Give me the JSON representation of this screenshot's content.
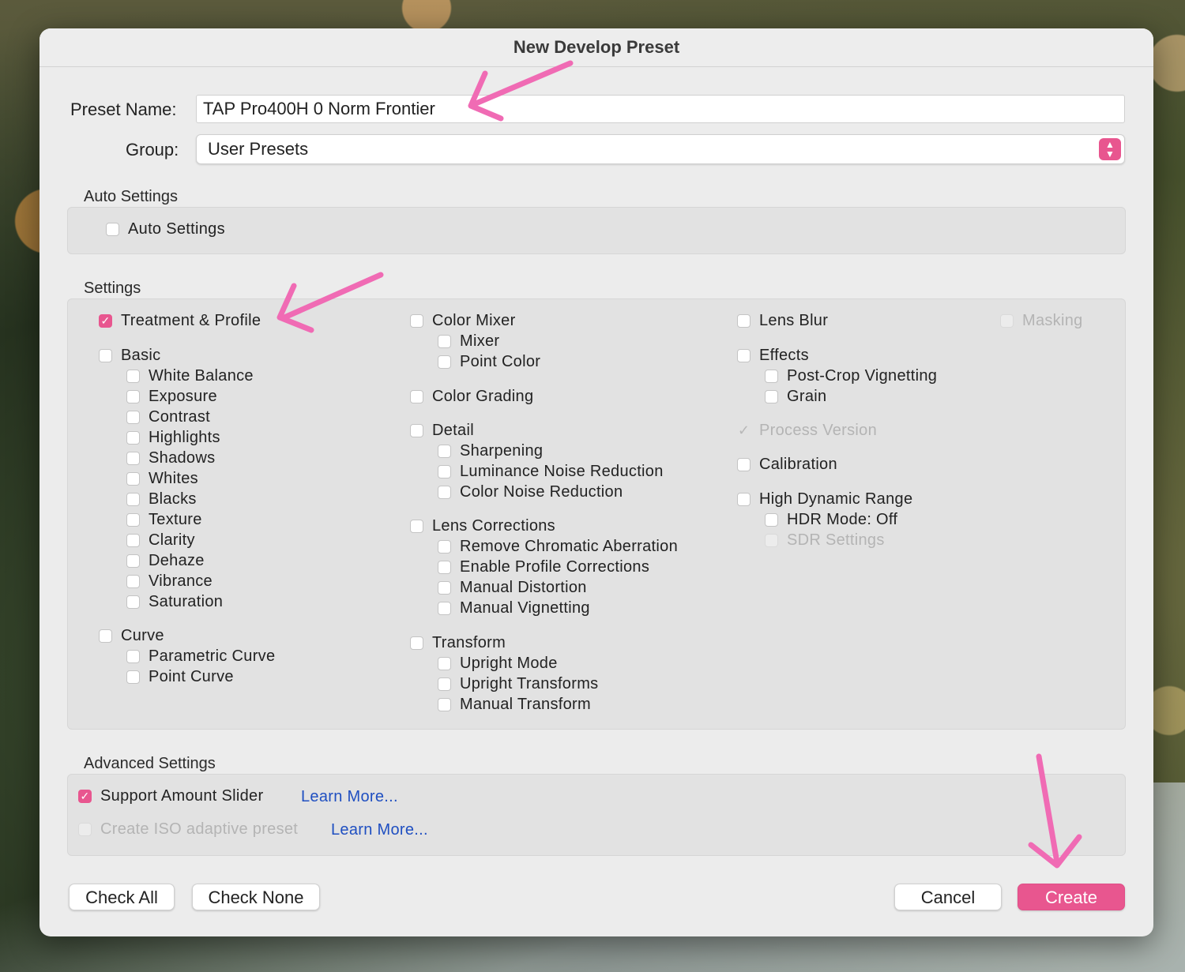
{
  "dialog": {
    "title": "New Develop Preset",
    "preset_name_label": "Preset Name:",
    "preset_name_value": "TAP Pro400H 0 Norm Frontier",
    "group_label": "Group:",
    "group_value": "User Presets"
  },
  "auto_settings": {
    "title": "Auto Settings",
    "checkbox": "Auto Settings"
  },
  "settings": {
    "title": "Settings",
    "col1": {
      "treatment": "Treatment & Profile",
      "basic": "Basic",
      "white_balance": "White Balance",
      "exposure": "Exposure",
      "contrast": "Contrast",
      "highlights": "Highlights",
      "shadows": "Shadows",
      "whites": "Whites",
      "blacks": "Blacks",
      "texture": "Texture",
      "clarity": "Clarity",
      "dehaze": "Dehaze",
      "vibrance": "Vibrance",
      "saturation": "Saturation",
      "curve": "Curve",
      "parametric_curve": "Parametric Curve",
      "point_curve": "Point Curve"
    },
    "col2": {
      "color_mixer": "Color Mixer",
      "mixer": "Mixer",
      "point_color": "Point Color",
      "color_grading": "Color Grading",
      "detail": "Detail",
      "sharpening": "Sharpening",
      "luminance_nr": "Luminance Noise Reduction",
      "color_nr": "Color Noise Reduction",
      "lens_corrections": "Lens Corrections",
      "remove_ca": "Remove Chromatic Aberration",
      "enable_profile": "Enable Profile Corrections",
      "manual_distortion": "Manual Distortion",
      "manual_vignetting": "Manual Vignetting",
      "transform": "Transform",
      "upright_mode": "Upright Mode",
      "upright_transforms": "Upright Transforms",
      "manual_transform": "Manual Transform"
    },
    "col3": {
      "lens_blur": "Lens Blur",
      "effects": "Effects",
      "post_crop": "Post-Crop Vignetting",
      "grain": "Grain",
      "process_version": "Process Version",
      "calibration": "Calibration",
      "hdr": "High Dynamic Range",
      "hdr_mode": "HDR Mode: Off",
      "sdr_settings": "SDR Settings"
    },
    "col4": {
      "masking": "Masking"
    }
  },
  "advanced": {
    "title": "Advanced Settings",
    "support_amount": "Support Amount Slider",
    "learn_more_1": "Learn More...",
    "iso_adaptive": "Create ISO adaptive preset",
    "learn_more_2": "Learn More..."
  },
  "footer": {
    "check_all": "Check All",
    "check_none": "Check None",
    "cancel": "Cancel",
    "create": "Create"
  },
  "colors": {
    "accent": "#e8568f",
    "annotation_arrow": "#f06bb4",
    "link": "#1f4fc1"
  },
  "icons": {
    "check": "check-icon",
    "stepper": "up-down-chevron-icon",
    "annotation": "arrow-annotation"
  }
}
